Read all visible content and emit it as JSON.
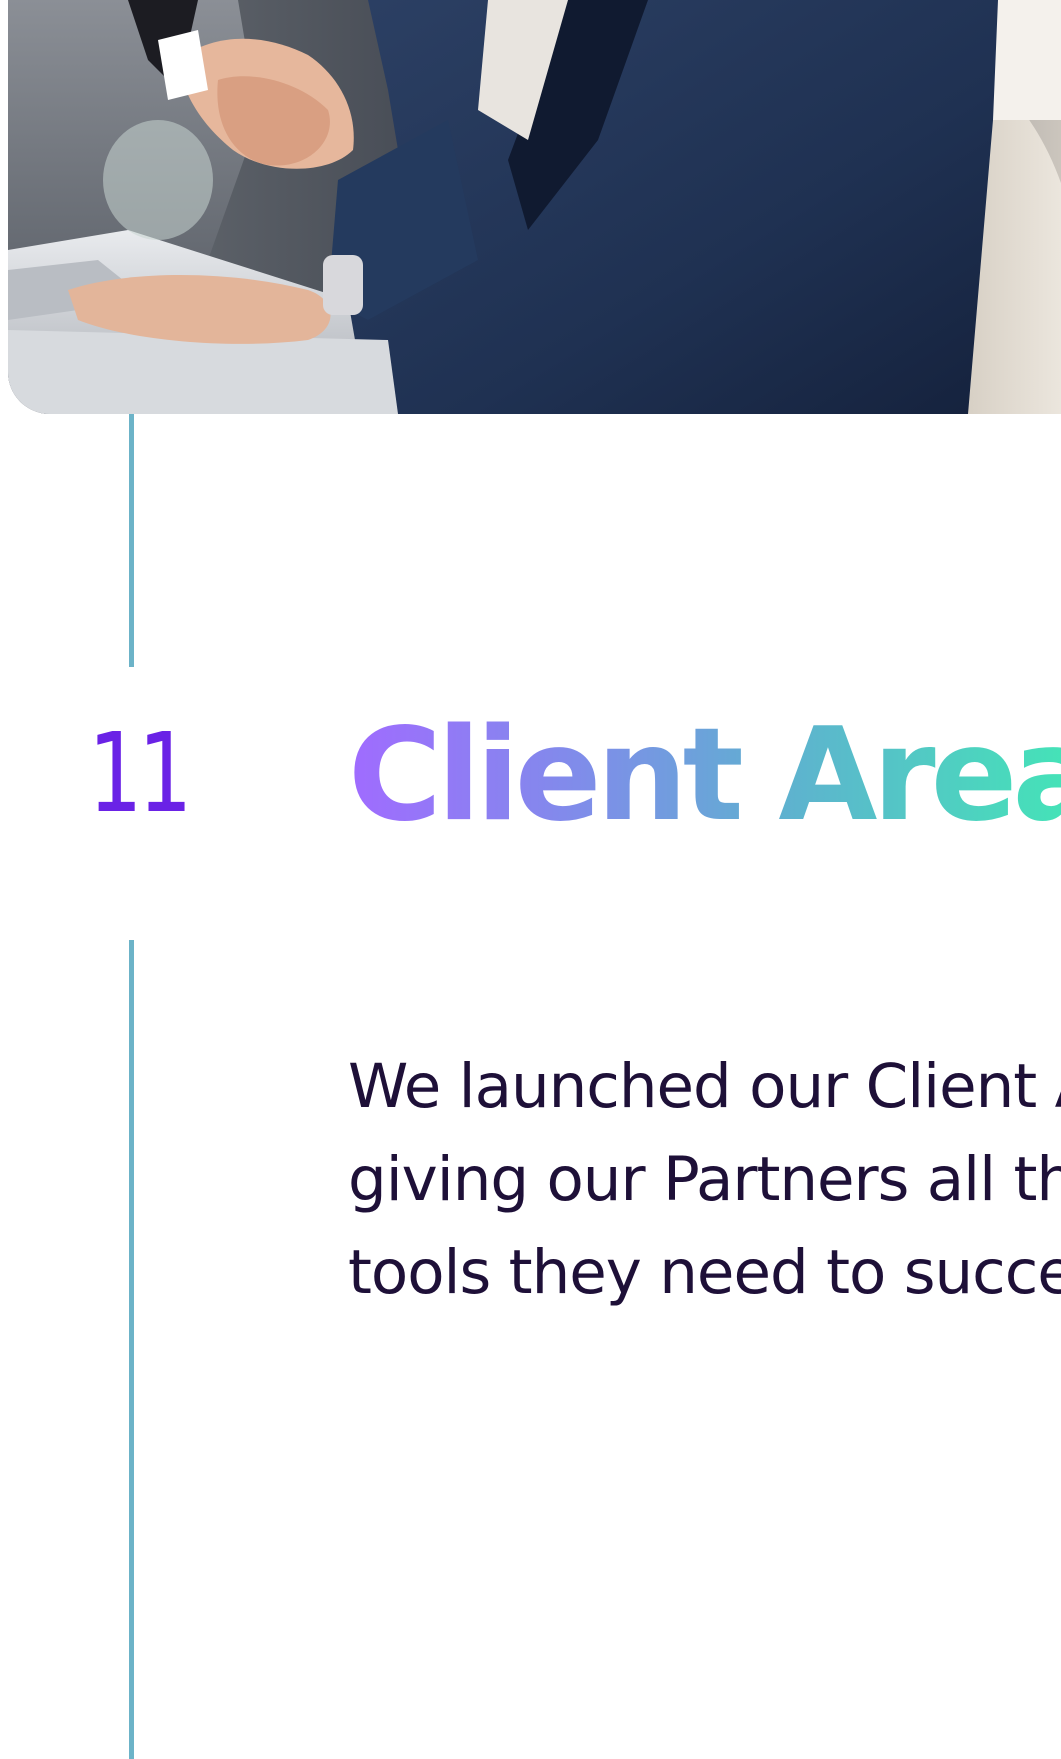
{
  "timeline_step": {
    "number": "11",
    "title": "Client Area",
    "description": "We launched our Client Area, giving our Partners all the tools they need to succeed"
  },
  "hero_image": {
    "subject": "business-handshake-photo"
  },
  "colors": {
    "number": "#6a22e6",
    "title_gradient_start": "#a06bff",
    "title_gradient_end": "#45e2b8",
    "timeline_line": "#6cb3c8",
    "body_text": "#1e1038",
    "background": "#ffffff"
  }
}
